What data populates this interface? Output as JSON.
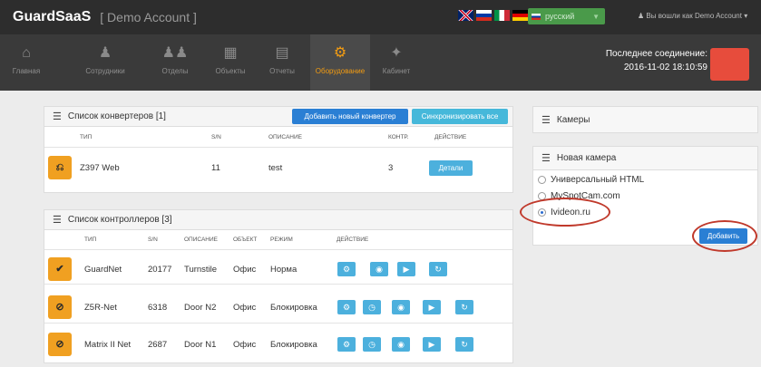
{
  "header": {
    "brand": "GuardSaaS",
    "account": "[ Demo Account ]",
    "language": "русский",
    "user": "Вы вошли как Demo Account"
  },
  "nav": {
    "items": [
      {
        "label": "Главная",
        "icon": "home-icon"
      },
      {
        "label": "Сотрудники",
        "icon": "user-icon"
      },
      {
        "label": "Отделы",
        "icon": "group-icon"
      },
      {
        "label": "Объекты",
        "icon": "sitemap-icon"
      },
      {
        "label": "Отчеты",
        "icon": "chart-icon"
      },
      {
        "label": "Оборудование",
        "icon": "gears-icon"
      },
      {
        "label": "Кабинет",
        "icon": "wrench-icon"
      }
    ],
    "active": "Оборудование"
  },
  "connection": {
    "label": "Последнее соединение:",
    "datetime": "2016-11-02 18:10:59"
  },
  "converters": {
    "title": "Список конвертеров [1]",
    "add_button": "Добавить новый конвертер",
    "sync_button": "Синхронизировать все",
    "headers": [
      "ТИП",
      "S/N",
      "ОПИСАНИЕ",
      "КОНТР.",
      "ДЕЙСТВИЕ"
    ],
    "rows": [
      {
        "type": "Z397 Web",
        "sn": "11",
        "desc": "test",
        "controllers": "3",
        "action": "Детали"
      }
    ]
  },
  "controllers": {
    "title": "Список контроллеров [3]",
    "headers": [
      "ТИП",
      "S/N",
      "ОПИСАНИЕ",
      "ОБЪЕКТ",
      "РЕЖИМ",
      "ДЕЙСТВИЕ"
    ],
    "rows": [
      {
        "type": "GuardNet",
        "sn": "20177",
        "desc": "Turnstile",
        "object": "Офис",
        "mode": "Норма"
      },
      {
        "type": "Z5R-Net",
        "sn": "6318",
        "desc": "Door N2",
        "object": "Офис",
        "mode": "Блокировка"
      },
      {
        "type": "Matrix II Net",
        "sn": "2687",
        "desc": "Door N1",
        "object": "Офис",
        "mode": "Блокировка"
      }
    ]
  },
  "cameras": {
    "title": "Камеры"
  },
  "new_camera": {
    "title": "Новая камера",
    "options": [
      "Универсальный HTML",
      "MySpotCam.com",
      "Ivideon.ru"
    ],
    "selected": "Ivideon.ru",
    "add_button": "Добавить"
  }
}
